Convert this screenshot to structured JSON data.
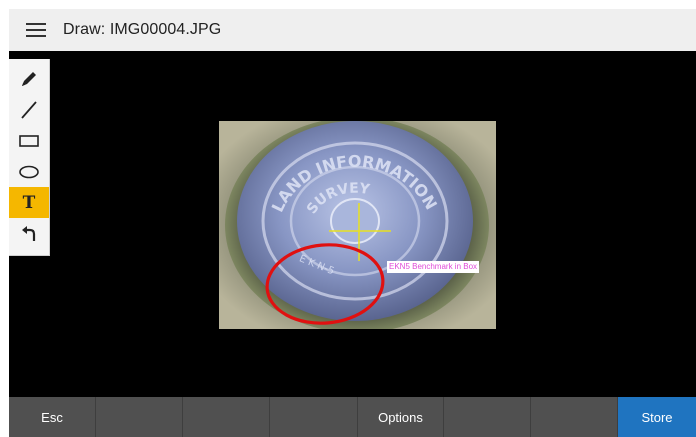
{
  "header": {
    "title": "Draw: IMG00004.JPG",
    "menu_icon": "hamburger-menu-icon"
  },
  "toolbox": {
    "tools": [
      {
        "name": "pencil",
        "icon": "pencil-icon",
        "active": false
      },
      {
        "name": "line",
        "icon": "line-icon",
        "active": false
      },
      {
        "name": "rectangle",
        "icon": "rectangle-icon",
        "active": false
      },
      {
        "name": "ellipse",
        "icon": "ellipse-icon",
        "active": false
      },
      {
        "name": "text",
        "icon": "text-icon",
        "label": "T",
        "active": true
      },
      {
        "name": "undo",
        "icon": "undo-icon",
        "active": false
      }
    ]
  },
  "annotation": {
    "label": "EKN5 Benchmark in Box",
    "marker_stamp_text": [
      "LAND INFORMATION",
      "SURVEY",
      "E K N-5"
    ],
    "colors": {
      "circle": "#e01010",
      "crosshair": "#e8e020",
      "label_text": "#e04bd8"
    }
  },
  "bottom_bar": {
    "buttons": [
      "Esc",
      "",
      "",
      "",
      "Options",
      "",
      "",
      "Store"
    ]
  },
  "colors": {
    "header_bg": "#efefef",
    "canvas_bg": "#000000",
    "active_tool": "#f5b700",
    "bottom_bar": "#505050",
    "store_button": "#1f74c0"
  }
}
